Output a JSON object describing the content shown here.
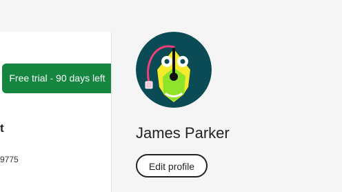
{
  "trial_banner": {
    "label": "Free trial - 90 days left"
  },
  "left_panel": {
    "heading_fragment": "t",
    "number_fragment": "9775"
  },
  "profile": {
    "avatar_icon": "pen-tool-avatar-icon",
    "name": "James Parker",
    "edit_label": "Edit profile"
  },
  "colors": {
    "trial_badge": "#14863f",
    "avatar_background": "#0a4b55",
    "avatar_pen": "#f2ea2a",
    "avatar_pen_accent": "#7ee22c",
    "avatar_handle": "#f03f7b",
    "text": "#222222"
  }
}
